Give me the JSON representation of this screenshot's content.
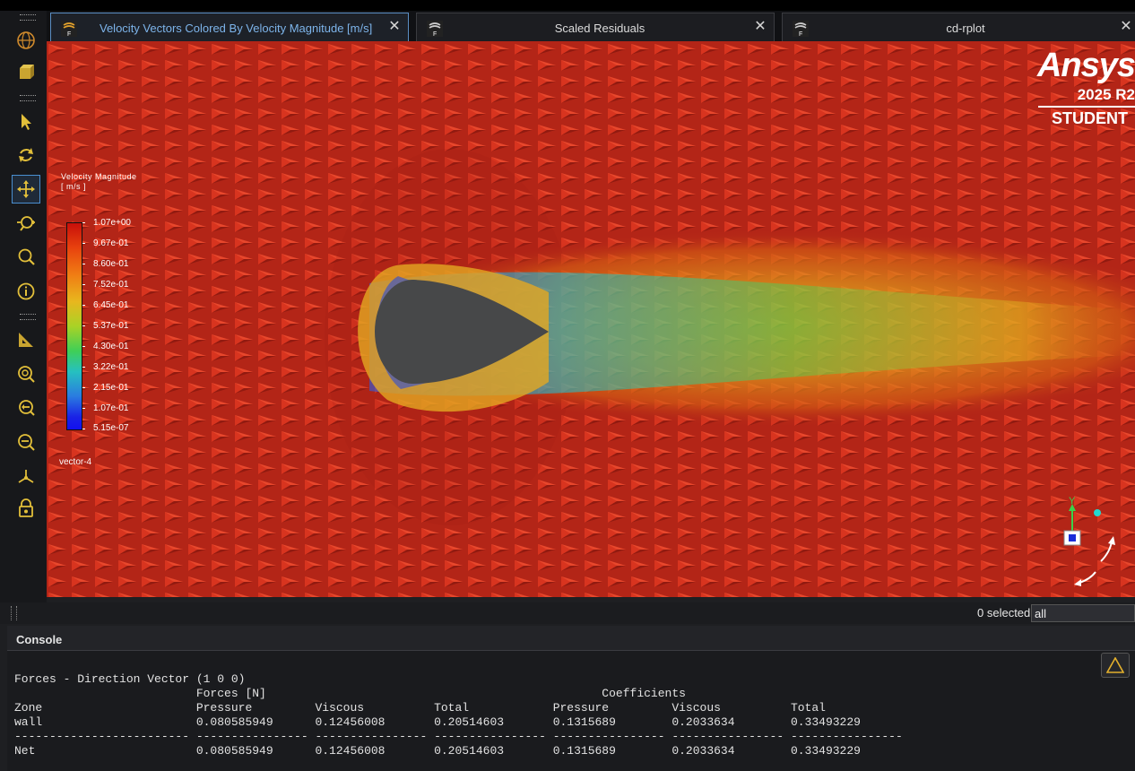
{
  "tabs": [
    {
      "label": "Velocity Vectors Colored By Velocity Magnitude [m/s]",
      "active": true,
      "close": "✕",
      "icon": "fluent-icon"
    },
    {
      "label": "Scaled Residuals",
      "active": false,
      "close": "✕",
      "icon": "fluent-icon"
    },
    {
      "label": "cd-rplot",
      "active": false,
      "close": "✕",
      "icon": "fluent-icon"
    }
  ],
  "toolbar": {
    "tools": [
      "mesh-sphere-icon",
      "display-icon",
      "select-icon",
      "rotate-icon",
      "pan-icon",
      "zoom-in-out-icon",
      "zoom-icon",
      "probe-info-icon",
      "ruler-icon",
      "fit-icon",
      "zoom-to-fit-icon",
      "zoom-box-icon",
      "axes-icon",
      "lock-view-icon"
    ]
  },
  "legend": {
    "title": "Velocity Magnitude",
    "unit": "[ m/s ]",
    "ticks": [
      "1.07e+00",
      "9.67e-01",
      "8.60e-01",
      "7.52e-01",
      "6.45e-01",
      "5.37e-01",
      "4.30e-01",
      "3.22e-01",
      "2.15e-01",
      "1.07e-01",
      "5.15e-07"
    ],
    "name": "vector-4"
  },
  "brand": {
    "name": "Ansys",
    "version": "2025 R2",
    "edition": "STUDENT"
  },
  "triad": {
    "y_label": "Y"
  },
  "status": {
    "selected_text": "0 selected",
    "filter_value": "all"
  },
  "console": {
    "title": "Console",
    "lines": [
      "Forces - Direction Vector (1 0 0)",
      "                          Forces [N]                                                Coefficients",
      "Zone                      Pressure         Viscous          Total            Pressure         Viscous          Total",
      "wall                      0.080585949      0.12456008       0.20514603       0.1315689        0.2033634        0.33493229",
      "------------------------- ---------------- ---------------- ---------------- ---------------- ---------------- ----------------",
      "Net                       0.080585949      0.12456008       0.20514603       0.1315689        0.2033634        0.33493229"
    ],
    "warning_icon": "warning-triangle-icon"
  }
}
